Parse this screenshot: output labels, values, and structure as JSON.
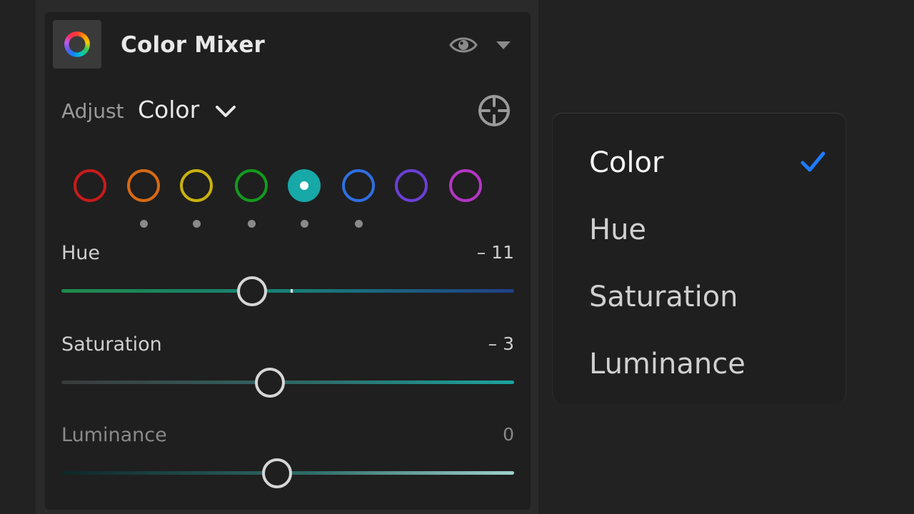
{
  "panel": {
    "title": "Color Mixer",
    "icons": {
      "header": "color-wheel-icon",
      "visibility": "eye-icon",
      "collapse": "caret-down-icon"
    }
  },
  "adjust": {
    "label": "Adjust",
    "value": "Color",
    "dropdown_icon": "chevron-down-icon",
    "target_icon": "targeted-adjustment-icon"
  },
  "swatches": [
    {
      "name": "red",
      "color": "#c81b1b",
      "selected": false,
      "modified": false
    },
    {
      "name": "orange",
      "color": "#d66a14",
      "selected": false,
      "modified": true
    },
    {
      "name": "yellow",
      "color": "#c9b30e",
      "selected": false,
      "modified": true
    },
    {
      "name": "green",
      "color": "#149a1e",
      "selected": false,
      "modified": true
    },
    {
      "name": "aqua",
      "color": "#17a8a8",
      "selected": true,
      "modified": true
    },
    {
      "name": "blue",
      "color": "#2f6fe0",
      "selected": false,
      "modified": true
    },
    {
      "name": "purple",
      "color": "#6c3fd6",
      "selected": false,
      "modified": false
    },
    {
      "name": "magenta",
      "color": "#b436c4",
      "selected": false,
      "modified": false
    }
  ],
  "sliders": [
    {
      "label": "Hue",
      "value": "– 11",
      "numeric": -11,
      "min": -100,
      "max": 100
    },
    {
      "label": "Saturation",
      "value": "– 3",
      "numeric": -3,
      "min": -100,
      "max": 100
    },
    {
      "label": "Luminance",
      "value": "0",
      "numeric": 0,
      "min": -100,
      "max": 100
    }
  ],
  "menu": {
    "items": [
      "Color",
      "Hue",
      "Saturation",
      "Luminance"
    ],
    "selected": "Color",
    "check_color": "#1e7bff",
    "check_icon": "checkmark-icon"
  },
  "colors": {
    "background": "#222222",
    "panel": "#1f1f1f",
    "accent": "#1e7bff"
  }
}
